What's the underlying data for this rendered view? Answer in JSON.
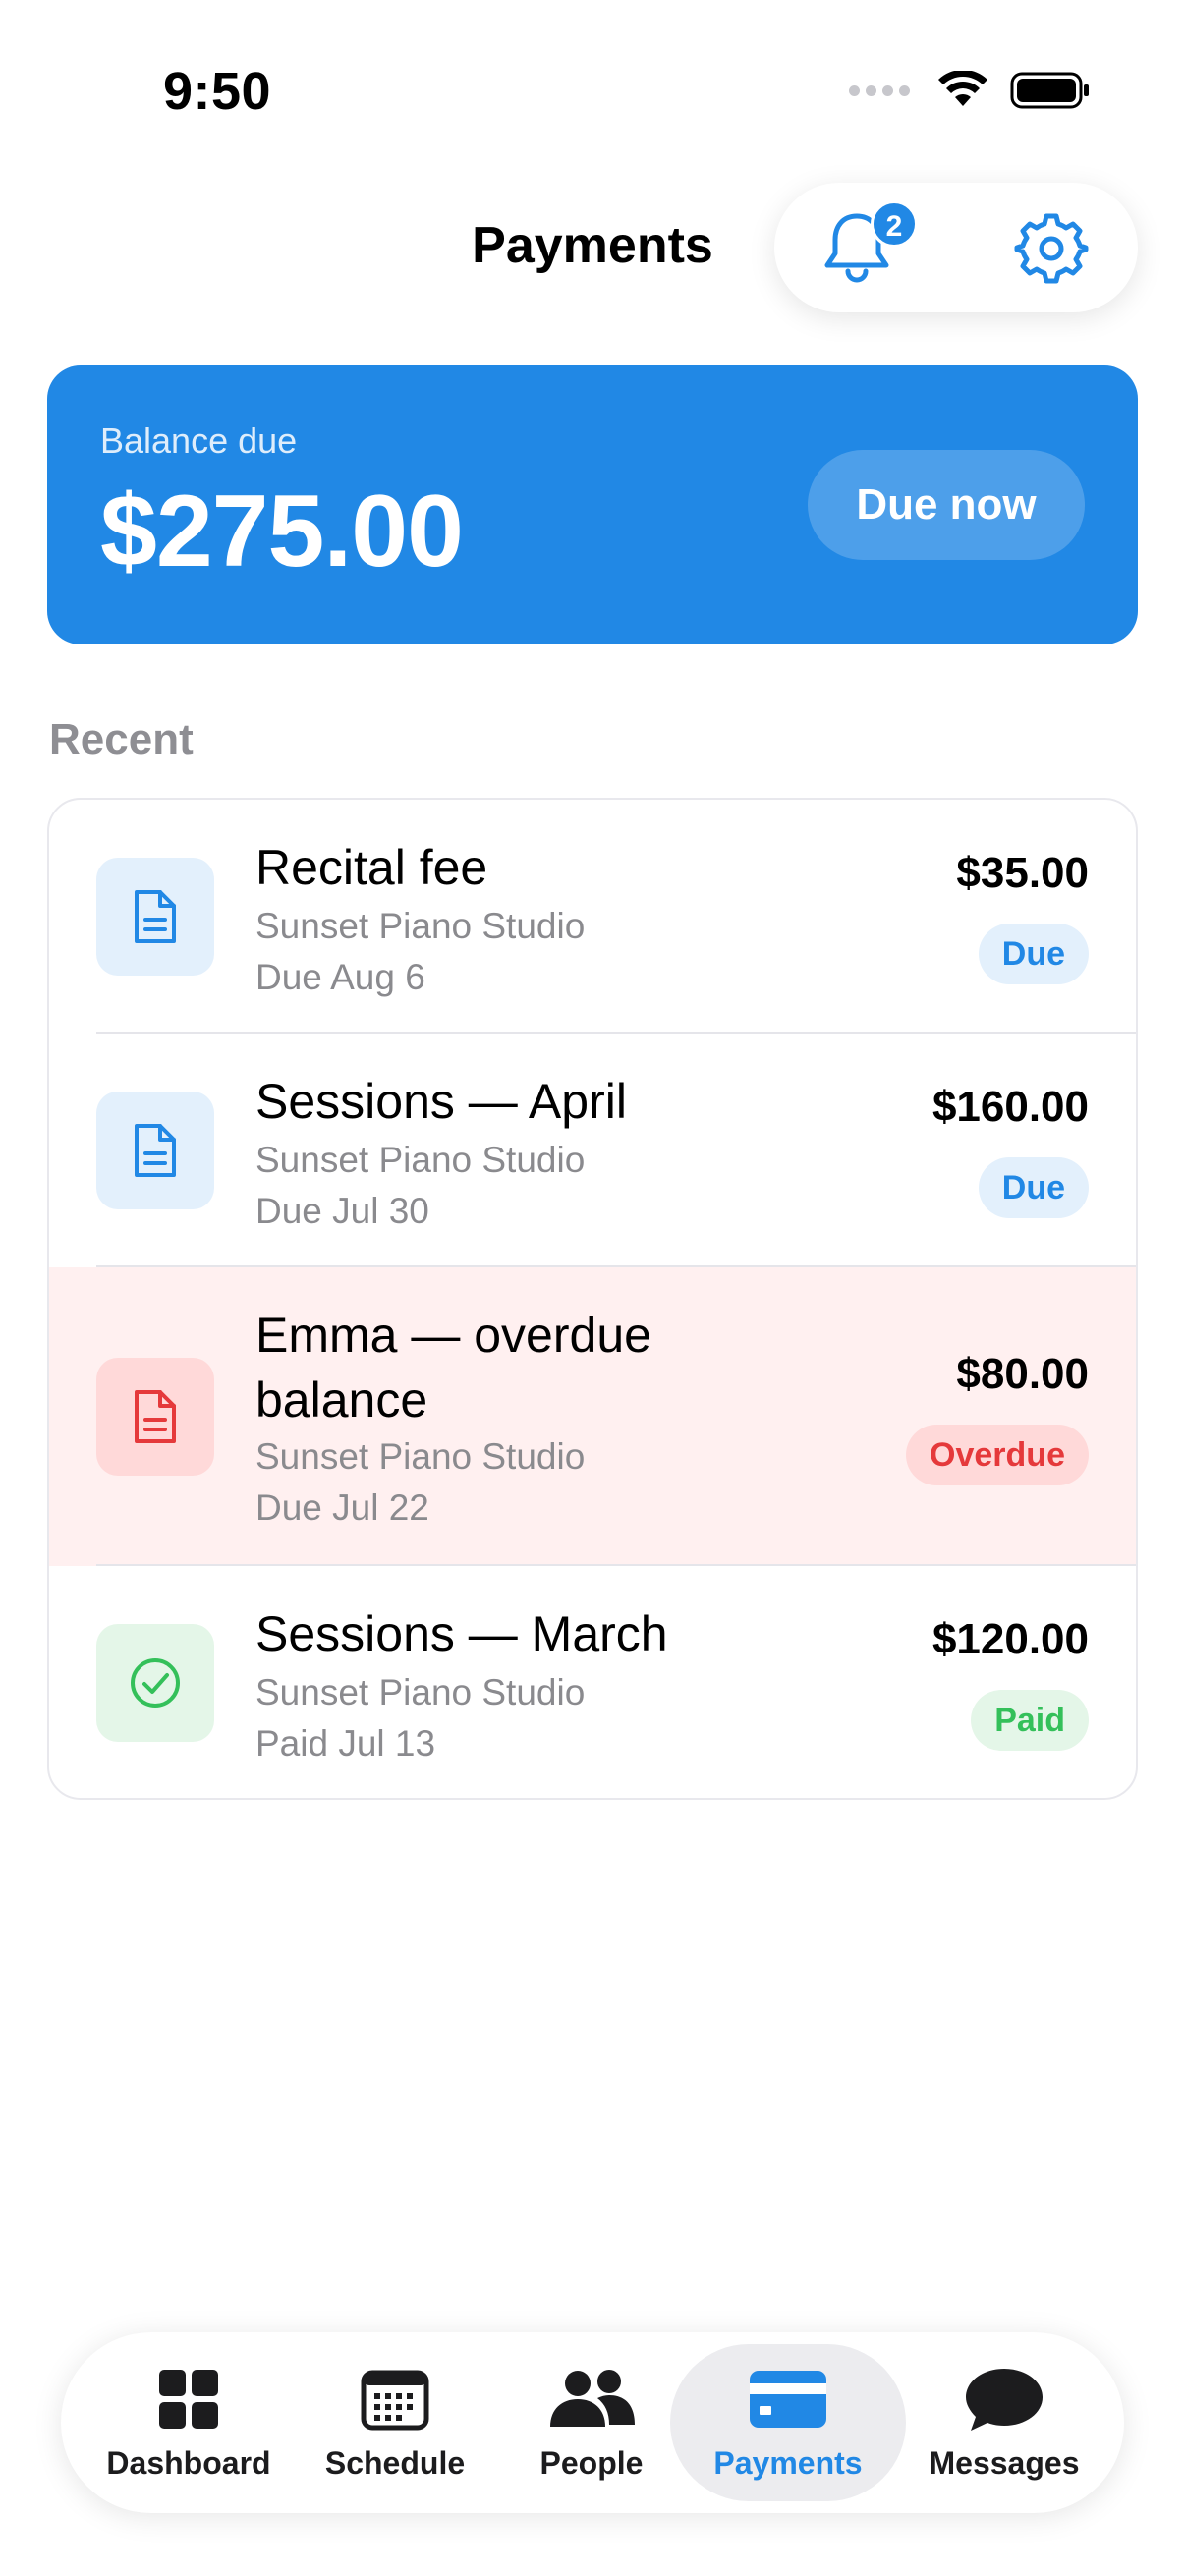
{
  "status_bar": {
    "time": "9:50"
  },
  "header": {
    "title": "Payments",
    "notification_count": "2"
  },
  "balance": {
    "label": "Balance due",
    "amount": "$275.00",
    "action_label": "Due now"
  },
  "recent": {
    "section_title": "Recent",
    "items": [
      {
        "title": "Recital fee",
        "studio": "Sunset Piano Studio",
        "date": "Due Aug 6",
        "amount": "$35.00",
        "status": "Due",
        "icon": "document-icon"
      },
      {
        "title": "Sessions — April",
        "studio": "Sunset Piano Studio",
        "date": "Due Jul 30",
        "amount": "$160.00",
        "status": "Due",
        "icon": "document-icon"
      },
      {
        "title": "Emma — overdue balance",
        "studio": "Sunset Piano Studio",
        "date": "Due Jul 22",
        "amount": "$80.00",
        "status": "Overdue",
        "icon": "document-icon"
      },
      {
        "title": "Sessions — March",
        "studio": "Sunset Piano Studio",
        "date": "Paid Jul 13",
        "amount": "$120.00",
        "status": "Paid",
        "icon": "check-circle-icon"
      }
    ]
  },
  "tab_bar": {
    "tabs": [
      {
        "label": "Dashboard",
        "icon": "grid-icon"
      },
      {
        "label": "Schedule",
        "icon": "calendar-icon"
      },
      {
        "label": "People",
        "icon": "people-icon"
      },
      {
        "label": "Payments",
        "icon": "credit-card-icon",
        "active": true
      },
      {
        "label": "Messages",
        "icon": "message-bubble-icon"
      }
    ]
  },
  "colors": {
    "accent": "#2188e5",
    "overdue": "#e5393b",
    "paid": "#34c05a",
    "overdue_row_bg": "#fff0f0"
  }
}
